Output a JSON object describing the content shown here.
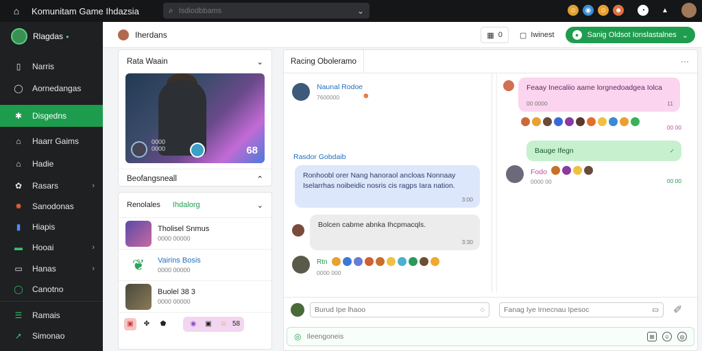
{
  "app": {
    "title": "Komunitam Game Ihdazsia"
  },
  "search": {
    "placeholder": "Isdiodbbams"
  },
  "topbar_icons": [
    "emoji-icon",
    "globe-icon",
    "emoji-icon",
    "emoji-icon",
    "clock-icon",
    "triangle-icon"
  ],
  "sidebar": {
    "user": "Rlagdas",
    "items": [
      {
        "label": "Narris",
        "icon": "phone-icon"
      },
      {
        "label": "Aornedangas",
        "icon": "chat-icon"
      },
      {
        "label": "Disgedns",
        "icon": "puzzle-icon",
        "active": true
      },
      {
        "label": "Haarr Gaims",
        "icon": "home-icon"
      },
      {
        "label": "Hadie",
        "icon": "home-icon"
      },
      {
        "label": "Rasars",
        "icon": "gear-icon",
        "chevron": true
      },
      {
        "label": "Sanodonas",
        "icon": "star-icon"
      },
      {
        "label": "Hiapis",
        "icon": "bookmark-icon"
      },
      {
        "label": "Hooai",
        "icon": "folder-icon",
        "chevron": true
      },
      {
        "label": "Hanas",
        "icon": "doc-icon",
        "chevron": true
      },
      {
        "label": "Canotno",
        "icon": "chat-icon"
      },
      {
        "label": "Ramais",
        "icon": "list-icon"
      },
      {
        "label": "Simonao",
        "icon": "rocket-icon"
      }
    ]
  },
  "header": {
    "title": "Iherdans",
    "count_label": "0",
    "notif_label": "Iwinest",
    "action_label": "Sanig Oldsot Ionslastalnes"
  },
  "left": {
    "card_title": "Rata Waain",
    "banner_sub": "0000\n0000",
    "banner_num": "68",
    "section_label": "Beofangsneall",
    "friends_tab1": "Renolales",
    "friends_tab2": "Ihdalorg",
    "friends": [
      {
        "name": "Tholisel Snmus",
        "sub": "0000 00000"
      },
      {
        "name": "Vairins Bosis",
        "sub": "0000 00000"
      },
      {
        "name": "Buolel 38 3",
        "sub": "0000 00000"
      }
    ],
    "quick": {
      "count": "58"
    }
  },
  "chat": {
    "tab": "Racing Oboleramo",
    "left": {
      "user1": {
        "name": "Naunal Rodoe",
        "time": "7600000"
      },
      "section": "Rasdor Gobdaib",
      "bubble1": {
        "text": "Ronhoobl orer Nang hanoraol ancloas Nonnaay Iselarrhas noibeidic nosris cis ragps Iara nation.",
        "meta": "3:00"
      },
      "bubble2": {
        "text": "Bolcen cabme abnka Ihcpmacqls.",
        "meta": "3:30"
      },
      "user3": {
        "name": "Rtn",
        "time": "0000 000"
      }
    },
    "right": {
      "bubble1": {
        "text": "Feaay Inecaliio aame lorgnedoadgea Iolca",
        "meta_left": "00 0000",
        "meta_right": "11"
      },
      "reactions_meta": "00 00",
      "bubble2": {
        "text": "Bauge Ifegn",
        "meta": "✓"
      },
      "user2": {
        "name": "Fodo",
        "time": "0000 00",
        "meta": "00 00"
      }
    },
    "input1_placeholder": "Burud Ipe lhaoo",
    "input2_placeholder": "Fanag Iye Irnecnau Ipesoc",
    "compose_placeholder": "Ileengoneis"
  },
  "colors": {
    "accent": "#1f9d4f",
    "bubble_blue": "#dde7fb",
    "bubble_gray": "#ececec",
    "bubble_pink": "#fbd5ef",
    "bubble_green": "#c7f0cf"
  }
}
